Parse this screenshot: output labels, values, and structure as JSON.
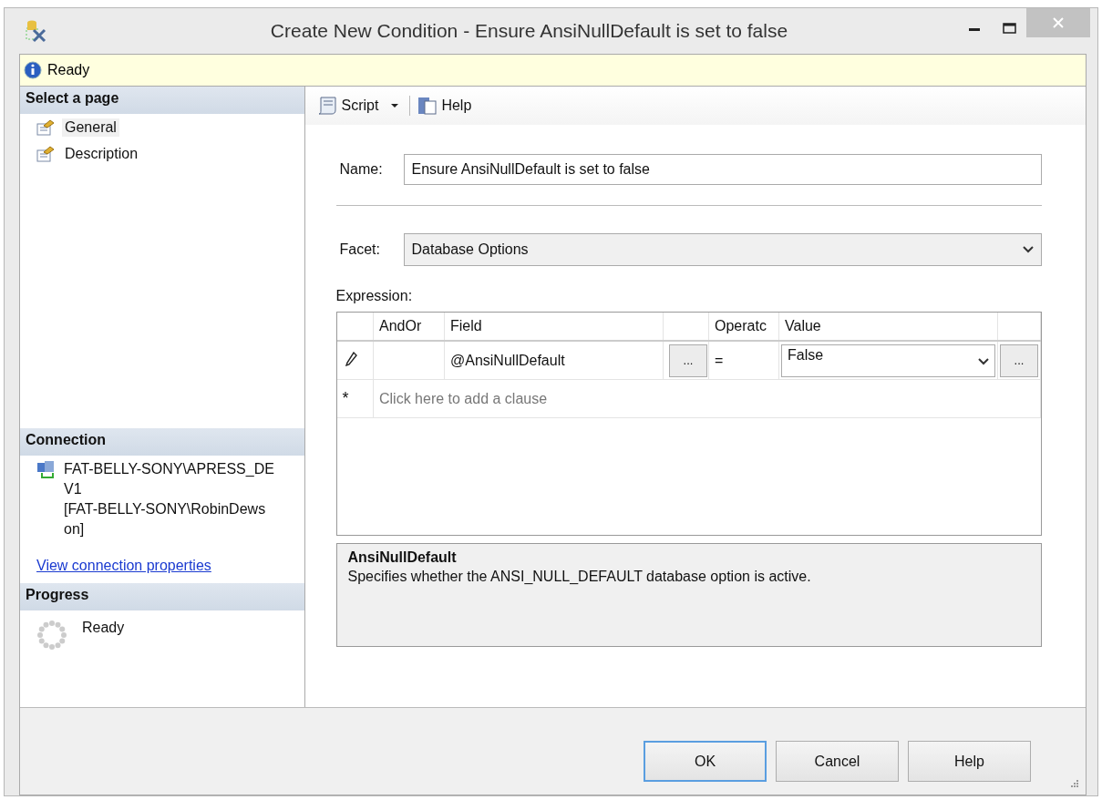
{
  "window": {
    "title": "Create New Condition - Ensure AnsiNullDefault is set to false"
  },
  "info_bar": {
    "text": "Ready"
  },
  "sidebar": {
    "select_page": {
      "heading": "Select a page",
      "pages": [
        {
          "label": "General",
          "selected": true
        },
        {
          "label": "Description",
          "selected": false
        }
      ]
    },
    "connection": {
      "heading": "Connection",
      "lines": [
        "FAT-BELLY-SONY\\APRESS_DE",
        "V1",
        "[FAT-BELLY-SONY\\RobinDews",
        "on]"
      ],
      "link": "View connection properties"
    },
    "progress": {
      "heading": "Progress",
      "status": "Ready"
    }
  },
  "toolbar": {
    "script": "Script",
    "help": "Help"
  },
  "form": {
    "name": {
      "label": "Name:",
      "value": "Ensure AnsiNullDefault is set to false"
    },
    "facet": {
      "label": "Facet:",
      "value": "Database Options"
    },
    "expression": {
      "label": "Expression:",
      "columns": [
        "AndOr",
        "Field",
        "Operatc",
        "Value"
      ],
      "rows": [
        {
          "andor": "",
          "field": "@AnsiNullDefault",
          "field_button": "...",
          "operator": "=",
          "value": "False",
          "value_button": "..."
        }
      ],
      "new_row": {
        "marker": "*",
        "placeholder": "Click here to add a clause"
      }
    },
    "description": {
      "title": "AnsiNullDefault",
      "text": "Specifies whether the ANSI_NULL_DEFAULT database option is active."
    }
  },
  "buttons": [
    {
      "label": "OK",
      "default": true
    },
    {
      "label": "Cancel",
      "default": false
    },
    {
      "label": "Help",
      "default": false
    }
  ]
}
